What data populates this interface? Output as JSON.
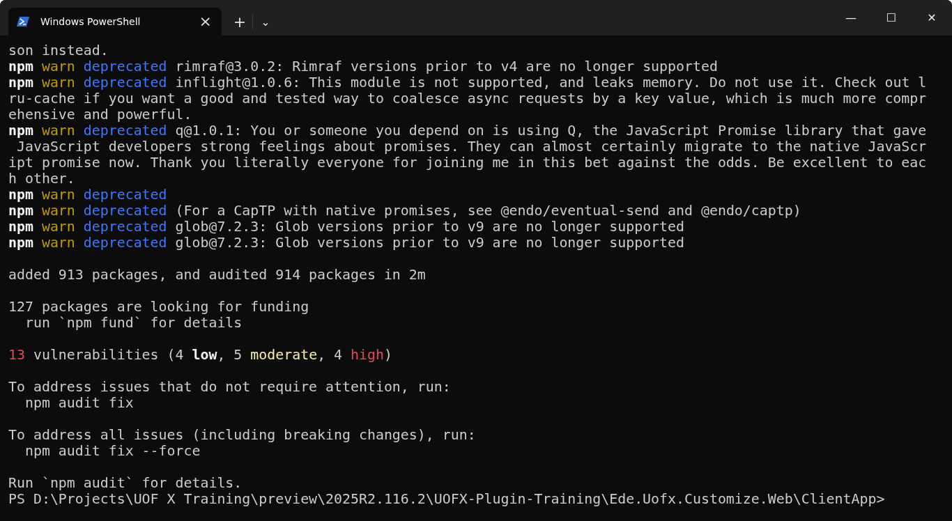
{
  "tab": {
    "title": "Windows PowerShell",
    "close": "×",
    "selected": true
  },
  "tab_actions": {
    "new": "+",
    "dropdown": "⌄"
  },
  "window_controls": {
    "minimize": "—",
    "maximize": "☐",
    "close": "✕"
  },
  "lines": [
    {
      "kind": "text",
      "segments": [
        {
          "kind": "plain",
          "text": "son instead."
        }
      ]
    },
    {
      "kind": "text",
      "segments": [
        {
          "kind": "bold",
          "text": "npm "
        },
        {
          "kind": "warn",
          "text": "warn "
        },
        {
          "kind": "deprecated",
          "text": "deprecated"
        },
        {
          "kind": "plain",
          "text": " rimraf@3.0.2: Rimraf versions prior to v4 are no longer supported"
        }
      ]
    },
    {
      "kind": "text",
      "segments": [
        {
          "kind": "bold",
          "text": "npm "
        },
        {
          "kind": "warn",
          "text": "warn "
        },
        {
          "kind": "deprecated",
          "text": "deprecated"
        },
        {
          "kind": "plain",
          "text": " inflight@1.0.6: This module is not supported, and leaks memory. Do not use it. Check out l"
        }
      ]
    },
    {
      "kind": "text",
      "segments": [
        {
          "kind": "plain",
          "text": "ru-cache if you want a good and tested way to coalesce async requests by a key value, which is much more compr"
        }
      ]
    },
    {
      "kind": "text",
      "segments": [
        {
          "kind": "plain",
          "text": "ehensive and powerful."
        }
      ]
    },
    {
      "kind": "text",
      "segments": [
        {
          "kind": "bold",
          "text": "npm "
        },
        {
          "kind": "warn",
          "text": "warn "
        },
        {
          "kind": "deprecated",
          "text": "deprecated"
        },
        {
          "kind": "plain",
          "text": " q@1.0.1: You or someone you depend on is using Q, the JavaScript Promise library that gave"
        }
      ]
    },
    {
      "kind": "text",
      "segments": [
        {
          "kind": "plain",
          "text": " JavaScript developers strong feelings about promises. They can almost certainly migrate to the native JavaScr"
        }
      ]
    },
    {
      "kind": "text",
      "segments": [
        {
          "kind": "plain",
          "text": "ipt promise now. Thank you literally everyone for joining me in this bet against the odds. Be excellent to eac"
        }
      ]
    },
    {
      "kind": "text",
      "segments": [
        {
          "kind": "plain",
          "text": "h other."
        }
      ]
    },
    {
      "kind": "text",
      "segments": [
        {
          "kind": "bold",
          "text": "npm "
        },
        {
          "kind": "warn",
          "text": "warn "
        },
        {
          "kind": "deprecated",
          "text": "deprecated"
        }
      ]
    },
    {
      "kind": "text",
      "segments": [
        {
          "kind": "bold",
          "text": "npm "
        },
        {
          "kind": "warn",
          "text": "warn "
        },
        {
          "kind": "deprecated",
          "text": "deprecated"
        },
        {
          "kind": "plain",
          "text": " (For a CapTP with native promises, see @endo/eventual-send and @endo/captp)"
        }
      ]
    },
    {
      "kind": "text",
      "segments": [
        {
          "kind": "bold",
          "text": "npm "
        },
        {
          "kind": "warn",
          "text": "warn "
        },
        {
          "kind": "deprecated",
          "text": "deprecated"
        },
        {
          "kind": "plain",
          "text": " glob@7.2.3: Glob versions prior to v9 are no longer supported"
        }
      ]
    },
    {
      "kind": "text",
      "segments": [
        {
          "kind": "bold",
          "text": "npm "
        },
        {
          "kind": "warn",
          "text": "warn "
        },
        {
          "kind": "deprecated",
          "text": "deprecated"
        },
        {
          "kind": "plain",
          "text": " glob@7.2.3: Glob versions prior to v9 are no longer supported"
        }
      ]
    },
    {
      "kind": "blank"
    },
    {
      "kind": "text",
      "segments": [
        {
          "kind": "plain",
          "text": "added 913 packages, and audited 914 packages in 2m"
        }
      ]
    },
    {
      "kind": "blank"
    },
    {
      "kind": "text",
      "segments": [
        {
          "kind": "plain",
          "text": "127 packages are looking for funding"
        }
      ]
    },
    {
      "kind": "text",
      "segments": [
        {
          "kind": "plain",
          "text": "  run `npm fund` for details"
        }
      ]
    },
    {
      "kind": "blank"
    },
    {
      "kind": "text",
      "segments": [
        {
          "kind": "error",
          "text": "13"
        },
        {
          "kind": "plain",
          "text": " vulnerabilities (4 "
        },
        {
          "kind": "bold",
          "text": "low"
        },
        {
          "kind": "plain",
          "text": ", 5 "
        },
        {
          "kind": "moderate",
          "text": "moderate"
        },
        {
          "kind": "plain",
          "text": ", 4 "
        },
        {
          "kind": "error",
          "text": "high"
        },
        {
          "kind": "plain",
          "text": ")"
        }
      ]
    },
    {
      "kind": "blank"
    },
    {
      "kind": "text",
      "segments": [
        {
          "kind": "plain",
          "text": "To address issues that do not require attention, run:"
        }
      ]
    },
    {
      "kind": "text",
      "segments": [
        {
          "kind": "plain",
          "text": "  npm audit fix"
        }
      ]
    },
    {
      "kind": "blank"
    },
    {
      "kind": "text",
      "segments": [
        {
          "kind": "plain",
          "text": "To address all issues (including breaking changes), run:"
        }
      ]
    },
    {
      "kind": "text",
      "segments": [
        {
          "kind": "plain",
          "text": "  npm audit fix --force"
        }
      ]
    },
    {
      "kind": "blank"
    },
    {
      "kind": "text",
      "segments": [
        {
          "kind": "plain",
          "text": "Run `npm audit` for details."
        }
      ]
    },
    {
      "kind": "text",
      "segments": [
        {
          "kind": "plain",
          "text": "PS D:\\Projects\\UOF X Training\\preview\\2025R2.116.2\\UOFX-Plugin-Training\\Ede.Uofx.Customize.Web\\ClientApp>"
        }
      ]
    }
  ]
}
